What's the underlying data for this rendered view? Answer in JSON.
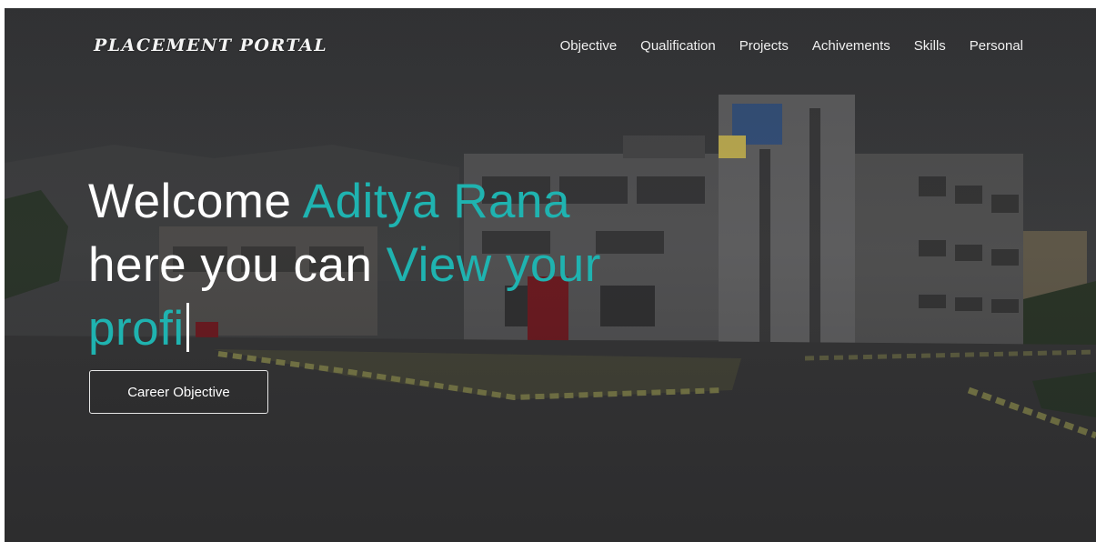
{
  "brand": {
    "title": "PLACEMENT PORTAL"
  },
  "nav": {
    "items": [
      "Objective",
      "Qualification",
      "Projects",
      "Achivements",
      "Skills",
      "Personal"
    ]
  },
  "hero": {
    "line1_prefix": "Welcome ",
    "line1_accent": "Aditya Rana",
    "line2_prefix": "here you can ",
    "line2_accent": "View your",
    "line3_typed": "profi",
    "cta_label": "Career Objective",
    "accent_color": "#1fb3b0"
  },
  "background": {
    "description_icon": "campus-building-photo"
  }
}
